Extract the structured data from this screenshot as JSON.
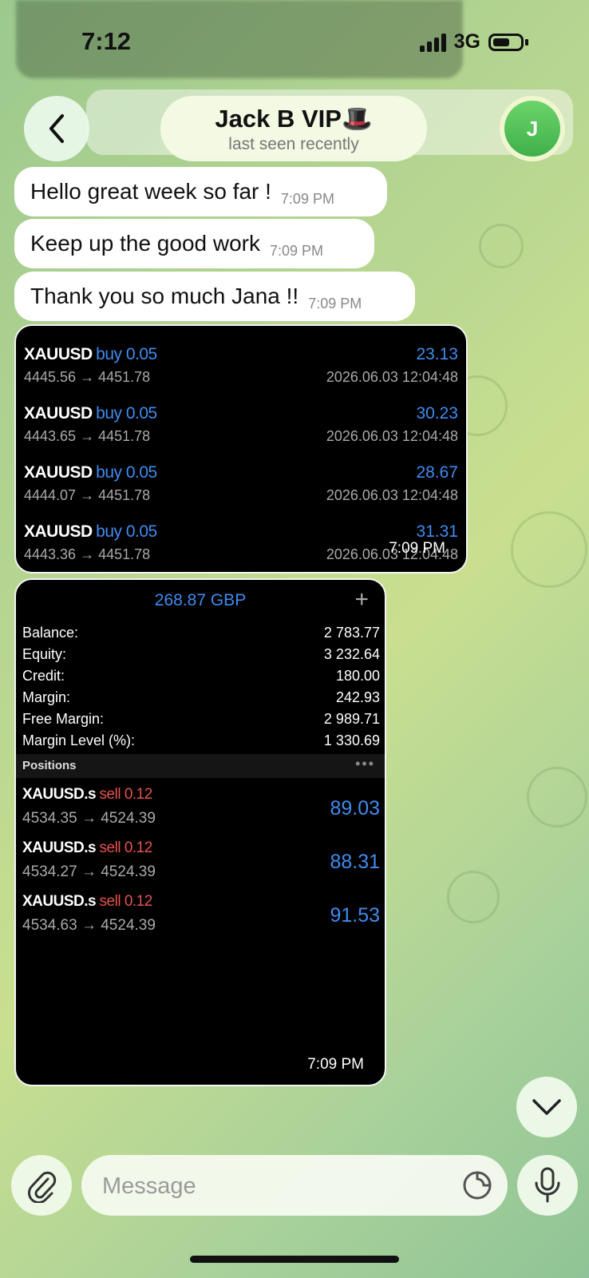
{
  "status_bar": {
    "time": "7:12",
    "network": "3G"
  },
  "header": {
    "name": "Jack B VIP🎩",
    "status": "last seen recently",
    "avatar_letter": "J"
  },
  "messages": [
    {
      "text": "Hello great week so far !",
      "time": "7:09 PM"
    },
    {
      "text": "Keep up the good work",
      "time": "7:09 PM"
    },
    {
      "text": "Thank you so much Jana !!",
      "time": "7:09 PM"
    }
  ],
  "trades_card": {
    "time": "7:09 PM",
    "trades": [
      {
        "symbol": "XAUUSD",
        "side": "buy 0.05",
        "profit": "23.13",
        "prices": "4445.56 → 4451.78",
        "date": "2026.06.03 12:04:48"
      },
      {
        "symbol": "XAUUSD",
        "side": "buy 0.05",
        "profit": "30.23",
        "prices": "4443.65 → 4451.78",
        "date": "2026.06.03 12:04:48"
      },
      {
        "symbol": "XAUUSD",
        "side": "buy 0.05",
        "profit": "28.67",
        "prices": "4444.07 → 4451.78",
        "date": "2026.06.03 12:04:48"
      },
      {
        "symbol": "XAUUSD",
        "side": "buy 0.05",
        "profit": "31.31",
        "prices": "4443.36 → 4451.78",
        "date": "2026.06.03 12:04:48"
      }
    ]
  },
  "account_card": {
    "total": "268.87 GBP",
    "plus": "+",
    "rows": [
      {
        "label": "Balance:",
        "value": "2 783.77"
      },
      {
        "label": "Equity:",
        "value": "3 232.64"
      },
      {
        "label": "Credit:",
        "value": "180.00"
      },
      {
        "label": "Margin:",
        "value": "242.93"
      },
      {
        "label": "Free Margin:",
        "value": "2 989.71"
      },
      {
        "label": "Margin Level (%):",
        "value": "1 330.69"
      }
    ],
    "positions_label": "Positions",
    "positions_more": "•••",
    "positions": [
      {
        "symbol": "XAUUSD.s",
        "side": "sell 0.12",
        "prices": "4534.35 → 4524.39",
        "profit": "89.03"
      },
      {
        "symbol": "XAUUSD.s",
        "side": "sell 0.12",
        "prices": "4534.27 → 4524.39",
        "profit": "88.31"
      },
      {
        "symbol": "XAUUSD.s",
        "side": "sell 0.12",
        "prices": "4534.63 → 4524.39",
        "profit": "91.53"
      }
    ],
    "time": "7:09 PM"
  },
  "composer": {
    "placeholder": "Message"
  },
  "colors": {
    "accent_blue": "#3f8cf0",
    "sell_red": "#e5534b",
    "avatar_green": "#4cbf52"
  }
}
